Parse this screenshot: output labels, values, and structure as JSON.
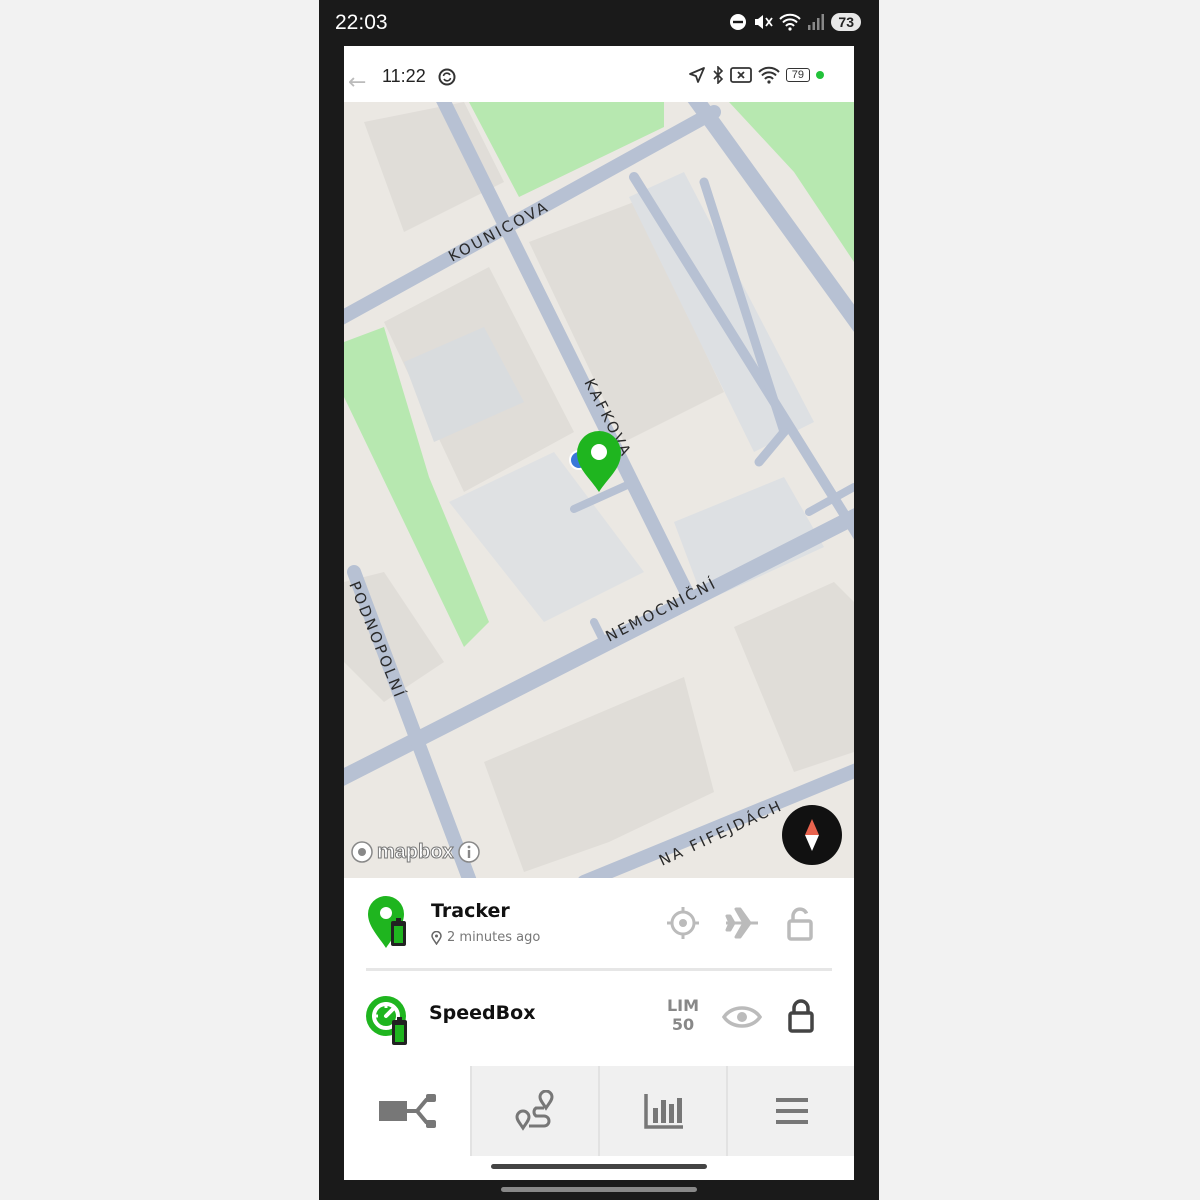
{
  "outer_status": {
    "time": "22:03",
    "battery": "73"
  },
  "inner_status": {
    "time": "11:22",
    "battery": "79"
  },
  "map": {
    "streets": [
      "KOUNICOVA",
      "KAFKOVA",
      "NEMOCNIČNÍ",
      "NA FIFEJDÁCH",
      "PODNOPOLNÍ"
    ],
    "attribution": "mapbox",
    "colors": {
      "land": "#ebe8e3",
      "road": "#b7c1d3",
      "park": "#b7e8b0",
      "marker": "#1fb51f"
    }
  },
  "devices": [
    {
      "name": "Tracker",
      "last_seen": "2 minutes ago",
      "icon": "map-pin-battery-icon",
      "actions": [
        "crosshair-icon",
        "airplane-icon",
        "unlock-icon"
      ]
    },
    {
      "name": "SpeedBox",
      "limit_label": "LIM",
      "limit_value": "50",
      "icon": "speedbox-battery-icon",
      "actions": [
        "eye-icon",
        "lock-icon"
      ]
    }
  ],
  "tabs": [
    {
      "id": "devices",
      "icon": "devices-connect-icon",
      "active": true
    },
    {
      "id": "routes",
      "icon": "route-icon",
      "active": false
    },
    {
      "id": "stats",
      "icon": "bar-chart-icon",
      "active": false
    },
    {
      "id": "menu",
      "icon": "hamburger-menu-icon",
      "active": false
    }
  ]
}
